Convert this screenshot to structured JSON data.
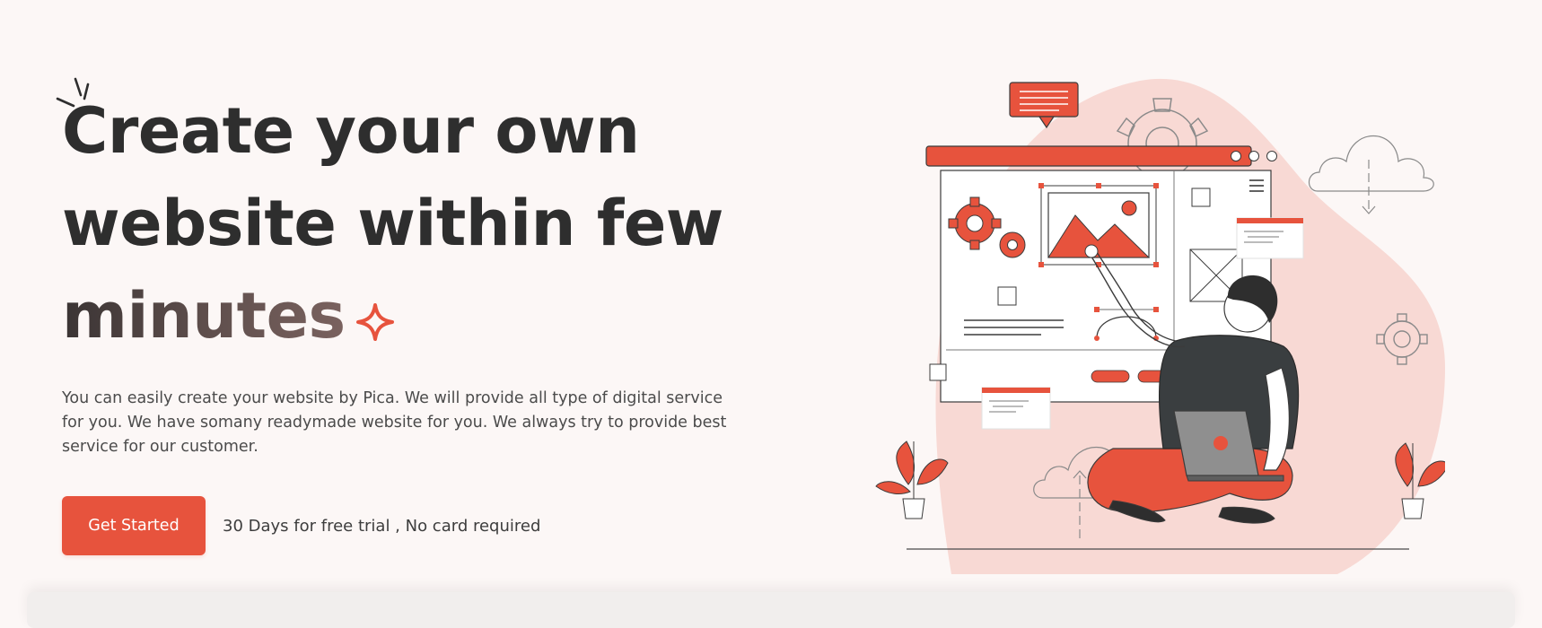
{
  "hero": {
    "title_line1": "Create your own",
    "title_line2": "website within few",
    "title_line3": "minutes",
    "description": "You can easily create your website by Pica. We will provide all type of digital service for you. We have somany readymade website for you. We always try to provide best service for our customer.",
    "cta_label": "Get Started",
    "trial_note": "30 Days for free trial , No card required"
  },
  "colors": {
    "accent": "#e7533d",
    "background": "#fcf7f6",
    "blob": "#f8d9d4",
    "ink": "#2e2e2e"
  },
  "icons": {
    "sparkle": "four-point-star-icon",
    "burst": "emphasis-burst-icon"
  }
}
